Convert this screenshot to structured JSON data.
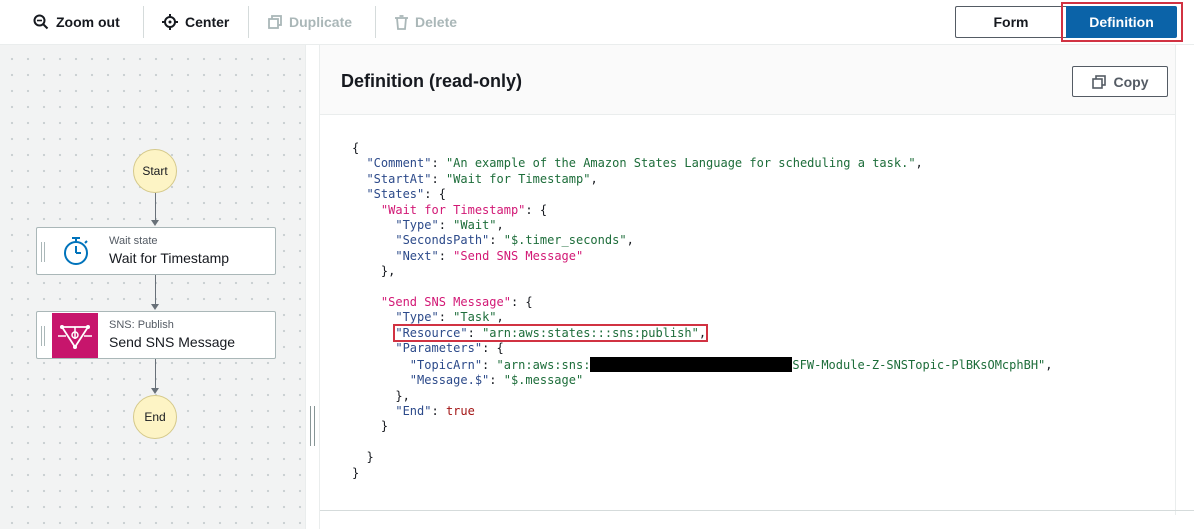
{
  "toolbar": {
    "zoom_out": "Zoom out",
    "center": "Center",
    "duplicate": "Duplicate",
    "delete": "Delete",
    "form": "Form",
    "definition": "Definition"
  },
  "graph": {
    "start": "Start",
    "end": "End",
    "states": [
      {
        "type": "Wait state",
        "name": "Wait for Timestamp",
        "icon": "stopwatch-icon"
      },
      {
        "type": "SNS: Publish",
        "name": "Send SNS Message",
        "icon": "sns-icon"
      }
    ]
  },
  "panel": {
    "title": "Definition (read-only)",
    "copy_label": "Copy"
  },
  "definition": {
    "comment_key": "\"Comment\"",
    "comment_val": "\"An example of the Amazon States Language for scheduling a task.\"",
    "startat_key": "\"StartAt\"",
    "startat_val": "\"Wait for Timestamp\"",
    "states_key": "\"States\"",
    "wait_name": "\"Wait for Timestamp\"",
    "type_key": "\"Type\"",
    "wait_type": "\"Wait\"",
    "secondspath_key": "\"SecondsPath\"",
    "secondspath_val": "\"$.timer_seconds\"",
    "next_key": "\"Next\"",
    "next_val": "\"Send SNS Message\"",
    "sns_name": "\"Send SNS Message\"",
    "task_type": "\"Task\"",
    "resource_key": "\"Resource\"",
    "resource_val": "\"arn:aws:states:::sns:publish\"",
    "parameters_key": "\"Parameters\"",
    "topicarn_key": "\"TopicArn\"",
    "topicarn_prefix": "\"arn:aws:sns:",
    "topicarn_suffix": "SFW-Module-Z-SNSTopic-PlBKsOMcphBH\"",
    "message_key": "\"Message.$\"",
    "message_val": "\"$.message\"",
    "end_key": "\"End\"",
    "end_val": "true"
  },
  "colors": {
    "accent": "#0b63a8",
    "highlight": "#d13242",
    "sns": "#c7156c",
    "start_end": "#fdf4c5"
  }
}
